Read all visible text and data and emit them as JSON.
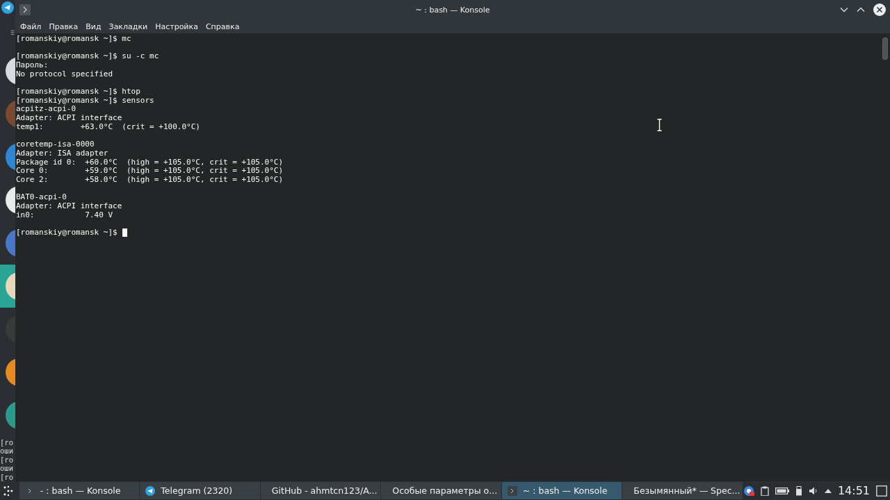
{
  "window": {
    "title": "~ : bash — Konsole"
  },
  "menu": [
    "Файл",
    "Правка",
    "Вид",
    "Закладки",
    "Настройка",
    "Справка"
  ],
  "terminal": {
    "blocks": [
      [
        "[romanskiy@romansk ~]$ mc"
      ],
      [
        "[romanskiy@romansk ~]$ su -c mc",
        "Пароль:",
        "No protocol specified"
      ],
      [
        "[romanskiy@romansk ~]$ htop",
        "[romanskiy@romansk ~]$ sensors",
        "acpitz-acpi-0",
        "Adapter: ACPI interface",
        "temp1:        +63.0°C  (crit = +100.0°C)"
      ],
      [
        "coretemp-isa-0000",
        "Adapter: ISA adapter",
        "Package id 0:  +60.0°C  (high = +105.0°C, crit = +105.0°C)",
        "Core 0:        +59.0°C  (high = +105.0°C, crit = +105.0°C)",
        "Core 2:        +58.0°C  (high = +105.0°C, crit = +105.0°C)"
      ],
      [
        "BAT0-acpi-0",
        "Adapter: ACPI interface",
        "in0:           7.40 V"
      ]
    ],
    "prompt": "[romanskiy@romansk ~]$"
  },
  "background_chats": [
    {
      "color": "#d8dce0",
      "selected": false
    },
    {
      "color": "#7a4a30",
      "selected": false
    },
    {
      "color": "#2f86d6",
      "selected": false
    },
    {
      "color": "#e8ece8",
      "selected": false
    },
    {
      "color": "#4a78c8",
      "selected": false
    },
    {
      "color": "#e6d8b8",
      "selected": true
    },
    {
      "color": "#3a3a3a",
      "selected": false
    },
    {
      "color": "#e88a20",
      "selected": false
    },
    {
      "color": "#2a9a8a",
      "selected": false
    }
  ],
  "background_text": [
    "[ro",
    "оши",
    "[ro",
    "оши",
    "[ro"
  ],
  "taskbar": {
    "tasks": [
      {
        "label": "- : bash — Konsole",
        "kind": "terminal",
        "selected": false
      },
      {
        "label": "Telegram (2320)",
        "kind": "messenger",
        "selected": false
      },
      {
        "label": "GitHub - ahmtcn123/A...",
        "kind": "browser",
        "selected": false
      },
      {
        "label": "Особые параметры о...",
        "kind": "settings",
        "selected": false
      },
      {
        "label": "~ : bash — Konsole",
        "kind": "terminal",
        "selected": true
      },
      {
        "label": "Безымянный* — Spec...",
        "kind": "screenshot",
        "selected": false
      }
    ],
    "clock": "14:51"
  }
}
